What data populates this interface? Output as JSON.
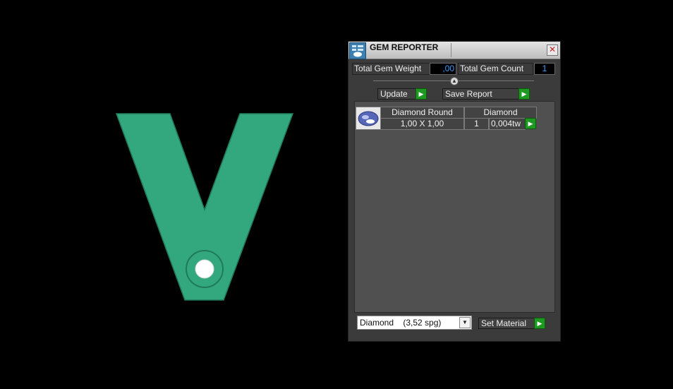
{
  "panel": {
    "title": "GEM REPORTER",
    "close_icon_label": "✕",
    "total_weight_label": "Total Gem Weight",
    "total_weight_value": ",00",
    "total_count_label": "Total Gem Count",
    "total_count_value": "1",
    "update_label": "Update",
    "save_report_label": "Save Report",
    "table": {
      "headers": [
        "Diamond Round",
        "Diamond"
      ],
      "rows": [
        {
          "size": "1,00 X 1,00",
          "count": "1",
          "weight": "0,004tw"
        }
      ]
    },
    "material_select_value": "Diamond    (3,52 spg)",
    "set_material_label": "Set Material"
  },
  "colors": {
    "model_fill": "#33a87e",
    "model_stroke": "#1f7a58",
    "go_button": "#1e9a22",
    "value_text": "#3aa0ff"
  },
  "icons": [
    "gem-reporter-app-icon",
    "close-icon",
    "collapse-toggle-icon",
    "arrow-right-icon",
    "gem-thumbnail-icon",
    "chevron-down-icon"
  ]
}
